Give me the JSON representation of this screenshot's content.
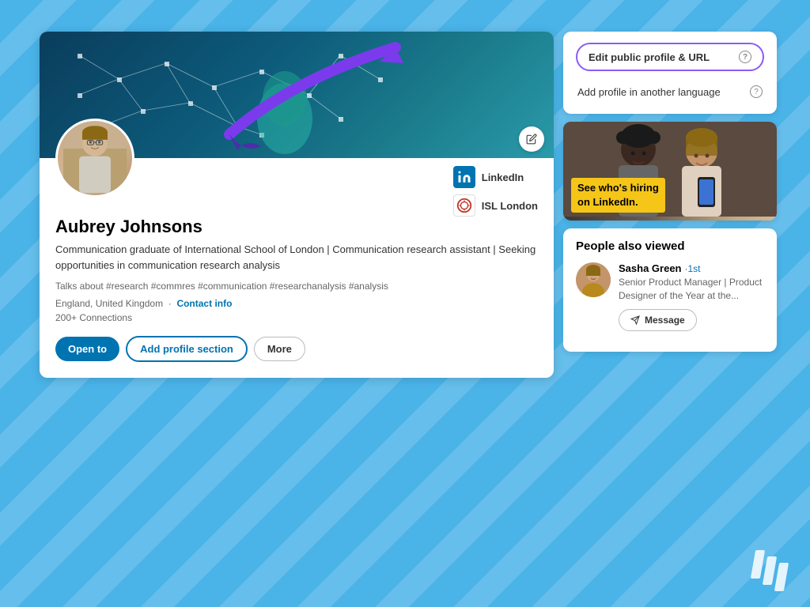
{
  "background": {
    "color": "#4ab3e8"
  },
  "profile_card": {
    "name": "Aubrey Johnsons",
    "headline": "Communication graduate of International School of London | Communication research assistant | Seeking opportunities in communication research analysis",
    "hashtags": "Talks about #research #commres #communication #researchanalysis #analysis",
    "location": "England, United Kingdom",
    "contact_info_label": "Contact info",
    "connections": "200+ Connections",
    "companies": [
      {
        "name": "LinkedIn",
        "logo_type": "linkedin"
      },
      {
        "name": "ISL London",
        "logo_type": "isl"
      }
    ],
    "actions": {
      "open_to": "Open to",
      "add_section": "Add profile section",
      "more": "More"
    }
  },
  "sidebar": {
    "edit_profile_btn": "Edit public profile & URL",
    "add_language_btn": "Add profile in another language",
    "help_icon": "?"
  },
  "ad": {
    "overlay_line1": "See who's hiring",
    "overlay_line2": "on LinkedIn."
  },
  "people_also_viewed": {
    "title": "People also viewed",
    "people": [
      {
        "name": "Sasha Green",
        "degree": "·1st",
        "title": "Senior Product Manager | Product Designer of the Year at the...",
        "message_label": "Message"
      }
    ]
  }
}
